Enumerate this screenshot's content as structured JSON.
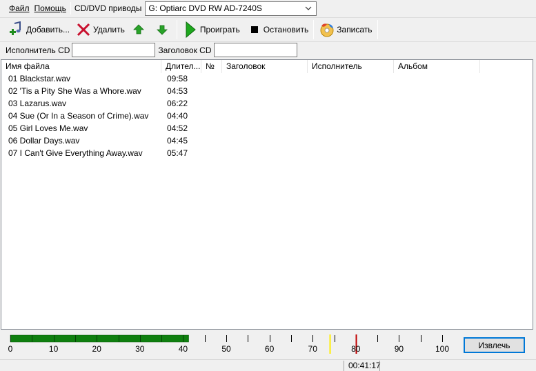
{
  "menu": {
    "file": "Файл",
    "help": "Помощь"
  },
  "drive": {
    "label": "CD/DVD приводы",
    "selected": "G: Optiarc DVD RW AD-7240S"
  },
  "toolbar": {
    "add": "Добавить...",
    "delete": "Удалить",
    "play": "Проиграть",
    "stop": "Остановить",
    "burn": "Записать"
  },
  "cd_info": {
    "artist_label": "Исполнитель CD",
    "artist_value": "",
    "title_label": "Заголовок CD",
    "title_value": ""
  },
  "table": {
    "columns": [
      "Имя файла",
      "Длител...",
      "№",
      "Заголовок",
      "Исполнитель",
      "Альбом"
    ],
    "rows": [
      {
        "name": "01 Blackstar.wav",
        "duration": "09:58"
      },
      {
        "name": "02 'Tis a Pity She Was a Whore.wav",
        "duration": "04:53"
      },
      {
        "name": "03 Lazarus.wav",
        "duration": "06:22"
      },
      {
        "name": "04 Sue (Or In a Season of Crime).wav",
        "duration": "04:40"
      },
      {
        "name": "05 Girl Loves Me.wav",
        "duration": "04:52"
      },
      {
        "name": "06 Dollar Days.wav",
        "duration": "04:45"
      },
      {
        "name": "07 I Can't Give Everything Away.wav",
        "duration": "05:47"
      }
    ]
  },
  "capacity": {
    "scale_labels": [
      "0",
      "10",
      "20",
      "30",
      "40",
      "50",
      "60",
      "70",
      "80",
      "90",
      "100"
    ],
    "used_minutes": 41.3,
    "yellow_marker": 74,
    "red_marker": 80,
    "max_minutes": 100,
    "fill_color": "#0f7f0f",
    "yellow_color": "#ffee00",
    "red_color": "#c00000"
  },
  "eject": "Извлечь",
  "status": {
    "total_time": "00:41:17"
  }
}
